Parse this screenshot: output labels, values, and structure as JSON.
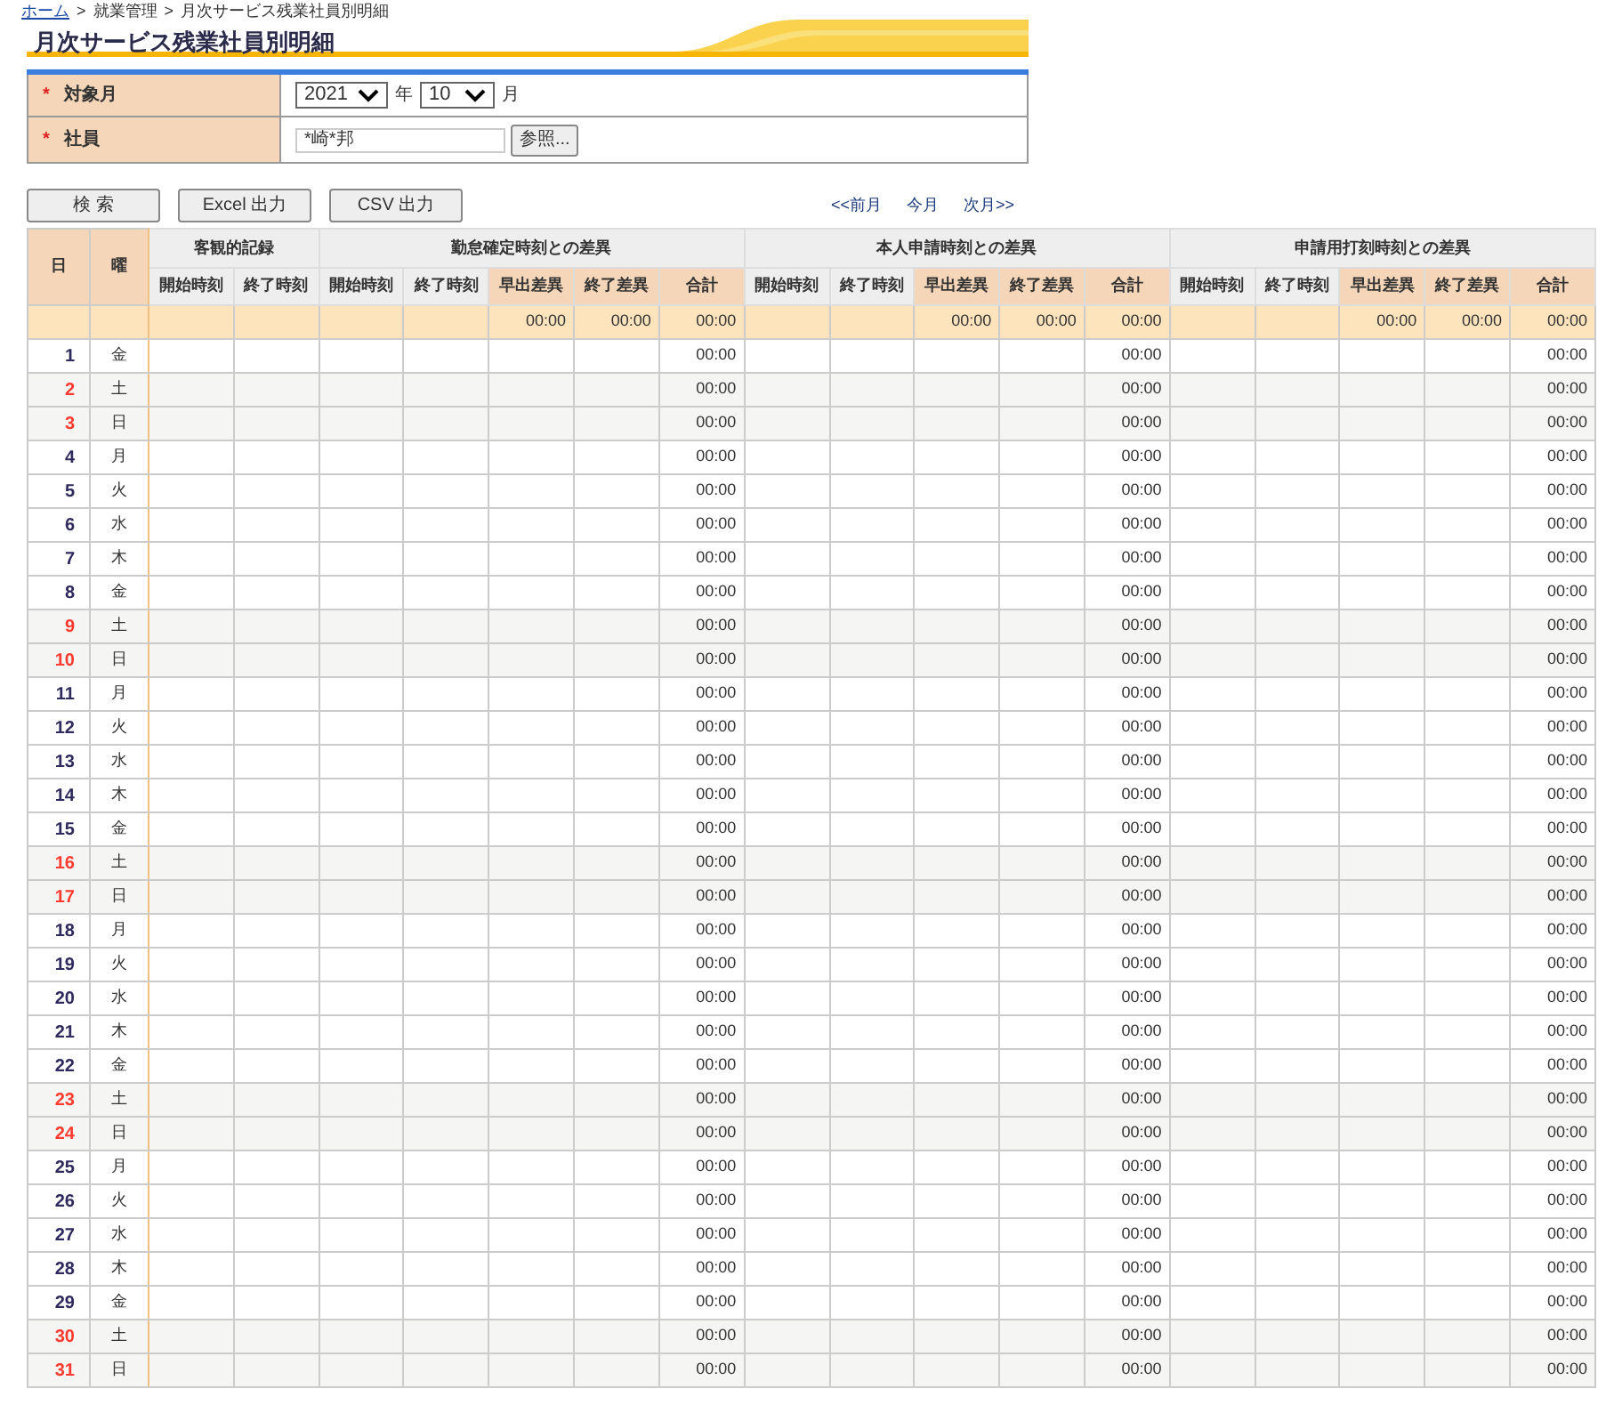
{
  "breadcrumb": {
    "items": [
      "ホーム",
      "就業管理",
      "月次サービス残業社員別明細"
    ],
    "separator": ">"
  },
  "title": "月次サービス残業社員別明細",
  "form": {
    "required_mark": "*",
    "target_month": {
      "label": "対象月",
      "required": true,
      "year": "2021",
      "year_unit": "年",
      "month": "10",
      "month_unit": "月"
    },
    "employee": {
      "label": "社員",
      "required": true,
      "value": "*崎*邦",
      "button": "参照..."
    }
  },
  "buttons": [
    "検 索",
    "Excel 出力",
    "CSV 出力"
  ],
  "month_nav": [
    "<<前月",
    "今月",
    "次月>>"
  ],
  "table": {
    "day_header": "日",
    "weekday_header": "曜",
    "groups": [
      {
        "title": "客観的記録",
        "columns": [
          {
            "label": "開始時刻",
            "kind": "time"
          },
          {
            "label": "終了時刻",
            "kind": "time"
          }
        ]
      },
      {
        "title": "勤怠確定時刻との差異",
        "columns": [
          {
            "label": "開始時刻",
            "kind": "time"
          },
          {
            "label": "終了時刻",
            "kind": "time"
          },
          {
            "label": "早出差異",
            "kind": "diff",
            "summary": "00:00"
          },
          {
            "label": "終了差異",
            "kind": "diff",
            "summary": "00:00"
          },
          {
            "label": "合計",
            "kind": "total",
            "summary": "00:00"
          }
        ]
      },
      {
        "title": "本人申請時刻との差異",
        "columns": [
          {
            "label": "開始時刻",
            "kind": "time"
          },
          {
            "label": "終了時刻",
            "kind": "time"
          },
          {
            "label": "早出差異",
            "kind": "diff",
            "summary": "00:00"
          },
          {
            "label": "終了差異",
            "kind": "diff",
            "summary": "00:00"
          },
          {
            "label": "合計",
            "kind": "total",
            "summary": "00:00"
          }
        ]
      },
      {
        "title": "申請用打刻時刻との差異",
        "columns": [
          {
            "label": "開始時刻",
            "kind": "time"
          },
          {
            "label": "終了時刻",
            "kind": "time"
          },
          {
            "label": "早出差異",
            "kind": "diff",
            "summary": "00:00"
          },
          {
            "label": "終了差異",
            "kind": "diff",
            "summary": "00:00"
          },
          {
            "label": "合計",
            "kind": "total",
            "summary": "00:00"
          }
        ]
      }
    ],
    "rows": [
      {
        "day": "1",
        "weekday": "金",
        "weekend": false,
        "totals": [
          "00:00",
          "00:00",
          "00:00"
        ]
      },
      {
        "day": "2",
        "weekday": "土",
        "weekend": true,
        "totals": [
          "00:00",
          "00:00",
          "00:00"
        ]
      },
      {
        "day": "3",
        "weekday": "日",
        "weekend": true,
        "totals": [
          "00:00",
          "00:00",
          "00:00"
        ]
      },
      {
        "day": "4",
        "weekday": "月",
        "weekend": false,
        "totals": [
          "00:00",
          "00:00",
          "00:00"
        ]
      },
      {
        "day": "5",
        "weekday": "火",
        "weekend": false,
        "totals": [
          "00:00",
          "00:00",
          "00:00"
        ]
      },
      {
        "day": "6",
        "weekday": "水",
        "weekend": false,
        "totals": [
          "00:00",
          "00:00",
          "00:00"
        ]
      },
      {
        "day": "7",
        "weekday": "木",
        "weekend": false,
        "totals": [
          "00:00",
          "00:00",
          "00:00"
        ]
      },
      {
        "day": "8",
        "weekday": "金",
        "weekend": false,
        "totals": [
          "00:00",
          "00:00",
          "00:00"
        ]
      },
      {
        "day": "9",
        "weekday": "土",
        "weekend": true,
        "totals": [
          "00:00",
          "00:00",
          "00:00"
        ]
      },
      {
        "day": "10",
        "weekday": "日",
        "weekend": true,
        "totals": [
          "00:00",
          "00:00",
          "00:00"
        ]
      },
      {
        "day": "11",
        "weekday": "月",
        "weekend": false,
        "totals": [
          "00:00",
          "00:00",
          "00:00"
        ]
      },
      {
        "day": "12",
        "weekday": "火",
        "weekend": false,
        "totals": [
          "00:00",
          "00:00",
          "00:00"
        ]
      },
      {
        "day": "13",
        "weekday": "水",
        "weekend": false,
        "totals": [
          "00:00",
          "00:00",
          "00:00"
        ]
      },
      {
        "day": "14",
        "weekday": "木",
        "weekend": false,
        "totals": [
          "00:00",
          "00:00",
          "00:00"
        ]
      },
      {
        "day": "15",
        "weekday": "金",
        "weekend": false,
        "totals": [
          "00:00",
          "00:00",
          "00:00"
        ]
      },
      {
        "day": "16",
        "weekday": "土",
        "weekend": true,
        "totals": [
          "00:00",
          "00:00",
          "00:00"
        ]
      },
      {
        "day": "17",
        "weekday": "日",
        "weekend": true,
        "totals": [
          "00:00",
          "00:00",
          "00:00"
        ]
      },
      {
        "day": "18",
        "weekday": "月",
        "weekend": false,
        "totals": [
          "00:00",
          "00:00",
          "00:00"
        ]
      },
      {
        "day": "19",
        "weekday": "火",
        "weekend": false,
        "totals": [
          "00:00",
          "00:00",
          "00:00"
        ]
      },
      {
        "day": "20",
        "weekday": "水",
        "weekend": false,
        "totals": [
          "00:00",
          "00:00",
          "00:00"
        ]
      },
      {
        "day": "21",
        "weekday": "木",
        "weekend": false,
        "totals": [
          "00:00",
          "00:00",
          "00:00"
        ]
      },
      {
        "day": "22",
        "weekday": "金",
        "weekend": false,
        "totals": [
          "00:00",
          "00:00",
          "00:00"
        ]
      },
      {
        "day": "23",
        "weekday": "土",
        "weekend": true,
        "totals": [
          "00:00",
          "00:00",
          "00:00"
        ]
      },
      {
        "day": "24",
        "weekday": "日",
        "weekend": true,
        "totals": [
          "00:00",
          "00:00",
          "00:00"
        ]
      },
      {
        "day": "25",
        "weekday": "月",
        "weekend": false,
        "totals": [
          "00:00",
          "00:00",
          "00:00"
        ]
      },
      {
        "day": "26",
        "weekday": "火",
        "weekend": false,
        "totals": [
          "00:00",
          "00:00",
          "00:00"
        ]
      },
      {
        "day": "27",
        "weekday": "水",
        "weekend": false,
        "totals": [
          "00:00",
          "00:00",
          "00:00"
        ]
      },
      {
        "day": "28",
        "weekday": "木",
        "weekend": false,
        "totals": [
          "00:00",
          "00:00",
          "00:00"
        ]
      },
      {
        "day": "29",
        "weekday": "金",
        "weekend": false,
        "totals": [
          "00:00",
          "00:00",
          "00:00"
        ]
      },
      {
        "day": "30",
        "weekday": "土",
        "weekend": true,
        "totals": [
          "00:00",
          "00:00",
          "00:00"
        ]
      },
      {
        "day": "31",
        "weekday": "日",
        "weekend": true,
        "totals": [
          "00:00",
          "00:00",
          "00:00"
        ]
      }
    ]
  }
}
